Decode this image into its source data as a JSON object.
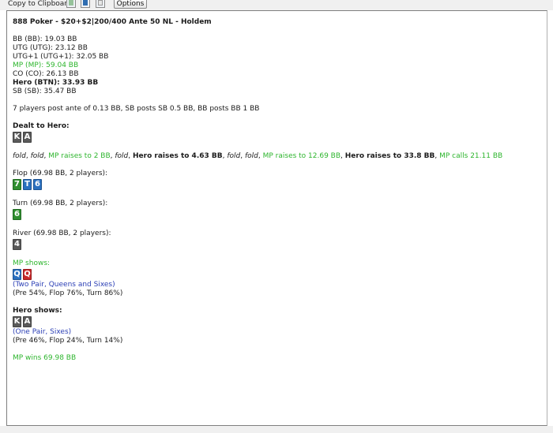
{
  "toolbar": {
    "copy_label": "Copy to Clipboard:",
    "options_label": "Options"
  },
  "hand": {
    "title": "888 Poker - $20+$2|200/400 Ante 50 NL - Holdem",
    "stacks": [
      {
        "text": "BB (BB): 19.03 BB",
        "style": "normal"
      },
      {
        "text": "UTG (UTG): 23.12 BB",
        "style": "normal"
      },
      {
        "text": "UTG+1 (UTG+1): 32.05 BB",
        "style": "normal"
      },
      {
        "text": "MP (MP): 59.04 BB",
        "style": "green"
      },
      {
        "text": "CO (CO): 26.13 BB",
        "style": "normal"
      },
      {
        "text": "Hero (BTN): 33.93 BB",
        "style": "bold"
      },
      {
        "text": "SB (SB): 35.47 BB",
        "style": "normal"
      }
    ],
    "blinds": "7 players post ante of 0.13 BB, SB posts SB 0.5 BB, BB posts BB 1 BB",
    "dealt_label": "Dealt to Hero:",
    "hero_cards": [
      {
        "rank": "K",
        "color": "#5a5a5a"
      },
      {
        "rank": "A",
        "color": "#5a5a5a"
      }
    ],
    "preflop_actions": [
      {
        "text": "fold",
        "style": "ital"
      },
      {
        "text": ", ",
        "style": "normal"
      },
      {
        "text": "fold",
        "style": "ital"
      },
      {
        "text": ", ",
        "style": "normal"
      },
      {
        "text": "MP raises to 2 BB",
        "style": "green"
      },
      {
        "text": ", ",
        "style": "normal"
      },
      {
        "text": "fold",
        "style": "ital"
      },
      {
        "text": ", ",
        "style": "normal"
      },
      {
        "text": "Hero raises to 4.63 BB",
        "style": "bold"
      },
      {
        "text": ", ",
        "style": "normal"
      },
      {
        "text": "fold",
        "style": "ital"
      },
      {
        "text": ", ",
        "style": "normal"
      },
      {
        "text": "fold",
        "style": "ital"
      },
      {
        "text": ", ",
        "style": "normal"
      },
      {
        "text": "MP raises to 12.69 BB",
        "style": "green"
      },
      {
        "text": ", ",
        "style": "normal"
      },
      {
        "text": "Hero raises to 33.8 BB",
        "style": "bold"
      },
      {
        "text": ", ",
        "style": "normal"
      },
      {
        "text": "MP calls 21.11 BB",
        "style": "green"
      }
    ],
    "flop_label": "Flop (69.98 BB, 2 players):",
    "flop_cards": [
      {
        "rank": "7",
        "color": "#2f8f2f"
      },
      {
        "rank": "T",
        "color": "#2a70c0"
      },
      {
        "rank": "6",
        "color": "#2a70c0"
      }
    ],
    "turn_label": "Turn (69.98 BB, 2 players):",
    "turn_cards": [
      {
        "rank": "6",
        "color": "#2f8f2f"
      }
    ],
    "river_label": "River (69.98 BB, 2 players):",
    "river_cards": [
      {
        "rank": "4",
        "color": "#5a5a5a"
      }
    ],
    "mp_shows_label": "MP shows:",
    "mp_cards": [
      {
        "rank": "Q",
        "color": "#2a70c0"
      },
      {
        "rank": "Q",
        "color": "#c8282a"
      }
    ],
    "mp_hand": "(Two Pair, Queens and Sixes)",
    "mp_equity": "(Pre 54%, Flop 76%, Turn 86%)",
    "hero_shows_label": "Hero shows:",
    "hero_show_cards": [
      {
        "rank": "K",
        "color": "#5a5a5a"
      },
      {
        "rank": "A",
        "color": "#5a5a5a"
      }
    ],
    "hero_hand": "(One Pair, Sixes)",
    "hero_equity": "(Pre 46%, Flop 24%, Turn 14%)",
    "result": "MP wins 69.98 BB"
  }
}
